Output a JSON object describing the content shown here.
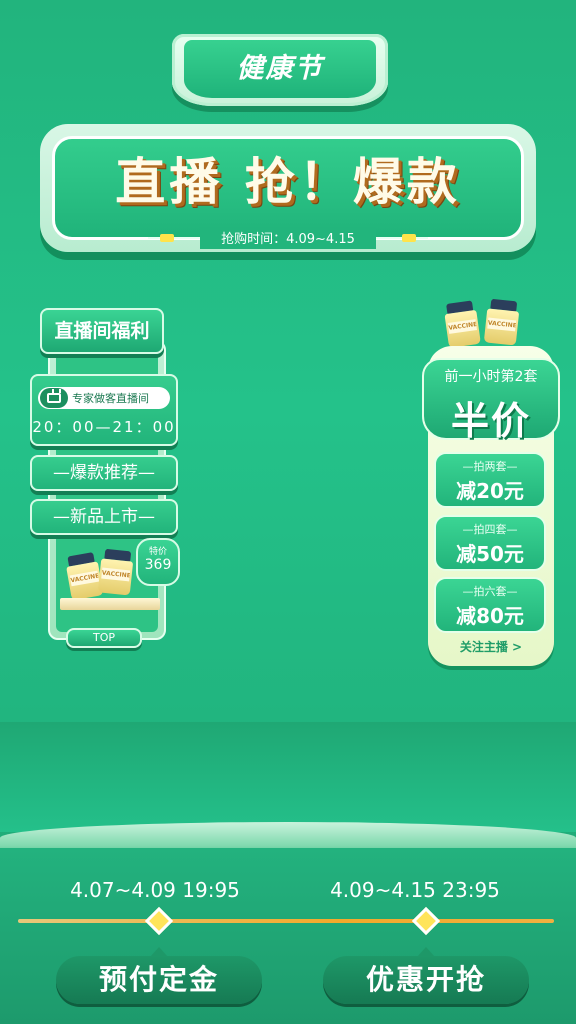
{
  "header": {
    "tag": "健康节",
    "title": "直播 抢！爆款",
    "sale_time": "抢购时间：4.09~4.15"
  },
  "left_panel": {
    "title": "直播间福利",
    "live_label": "专家做客直播间",
    "live_time": "20：00—21：00",
    "menu": [
      {
        "label": "—爆款推荐—"
      },
      {
        "label": "—新品上市—"
      }
    ],
    "price_label": "特价",
    "price_value": "369",
    "top_label": "TOP"
  },
  "right_panel": {
    "subtitle": "前一小时第2套",
    "headline": "半价",
    "deals": [
      {
        "condition": "—拍两套—",
        "discount": "减20元"
      },
      {
        "condition": "—拍四套—",
        "discount": "减50元"
      },
      {
        "condition": "—拍六套—",
        "discount": "减80元"
      }
    ],
    "follow": "关注主播 >"
  },
  "product": {
    "jar_label": "VACCINE"
  },
  "timeline": {
    "phase1_date": "4.07~4.09 19:95",
    "phase2_date": "4.09~4.15 23:95",
    "phase1_button": "预付定金",
    "phase2_button": "优惠开抢"
  },
  "colors": {
    "background": "#22b47d",
    "accent_yellow": "#ffe45a",
    "title_shadow": "#b06a1e"
  }
}
